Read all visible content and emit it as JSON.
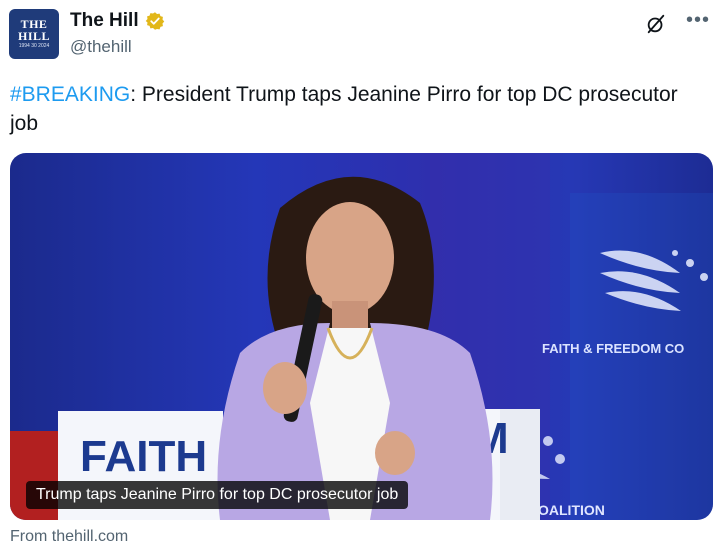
{
  "account": {
    "display_name": "The Hill",
    "handle": "@thehill",
    "avatar_line1": "THE",
    "avatar_line2": "HILL",
    "avatar_line3": "1994 30 2024",
    "verified_color": "#e2b719"
  },
  "tweet": {
    "hashtag": "#BREAKING",
    "body": ": President Trump taps Jeanine Pirro for top DC prosecutor job"
  },
  "card": {
    "caption": "Trump taps Jeanine Pirro for top DC prosecutor job",
    "stage_text": "FAITH",
    "stage_text_right": "M",
    "banner_text": "FAITH & FREEDOM CO",
    "banner_text_lower": "EDOM COALITION"
  },
  "source": "From thehill.com",
  "icons": {
    "grok": "grok-icon",
    "more": "more-options-icon",
    "verified": "verified-badge-icon"
  },
  "colors": {
    "hashtag": "#1d9bf0",
    "muted": "#536471",
    "card_bg": "#2437b8"
  }
}
